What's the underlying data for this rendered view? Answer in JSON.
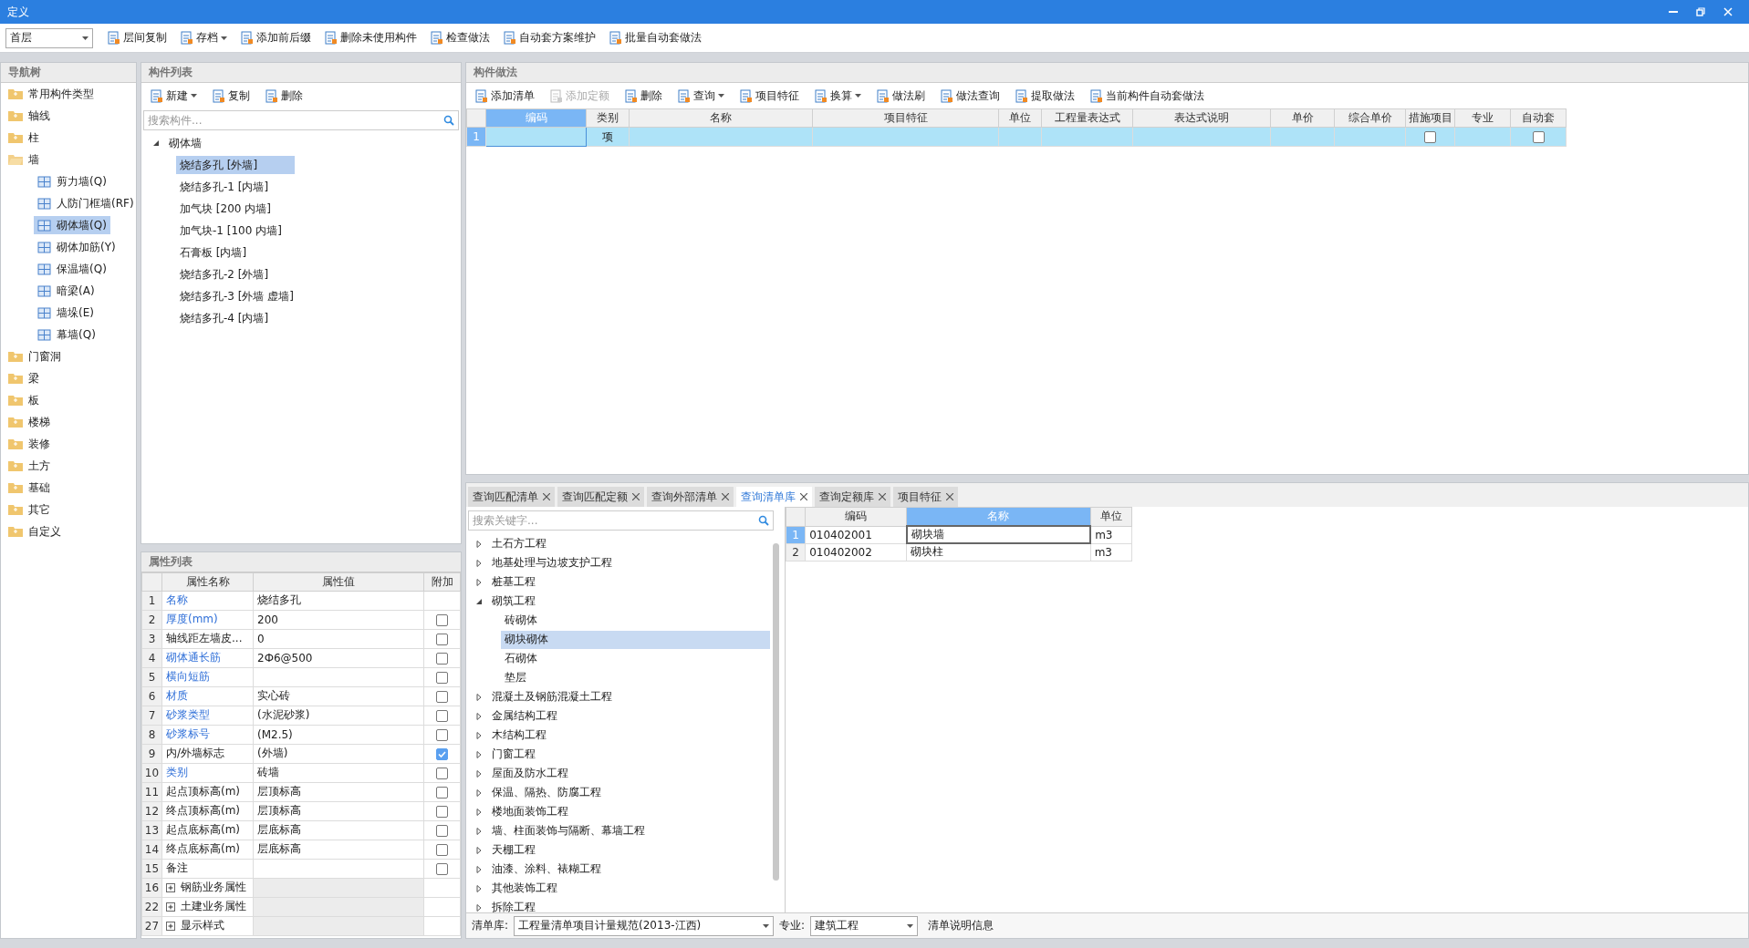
{
  "window": {
    "title": "定义"
  },
  "toolbar": {
    "floor": "首层",
    "buttons": [
      {
        "label": "层间复制",
        "dropdown": false
      },
      {
        "label": "存档",
        "dropdown": true
      },
      {
        "label": "添加前后缀",
        "dropdown": false
      },
      {
        "label": "删除未使用构件",
        "dropdown": false
      },
      {
        "label": "检查做法",
        "dropdown": false
      },
      {
        "label": "自动套方案维护",
        "dropdown": false
      },
      {
        "label": "批量自动套做法",
        "dropdown": false
      }
    ]
  },
  "nav_tree": {
    "title": "导航树",
    "items": [
      {
        "label": "常用构件类型",
        "expanded": false
      },
      {
        "label": "轴线",
        "expanded": false
      },
      {
        "label": "柱",
        "expanded": false
      },
      {
        "label": "墙",
        "expanded": true,
        "children": [
          {
            "label": "剪力墙(Q)",
            "selected": false
          },
          {
            "label": "人防门框墙(RF)",
            "selected": false
          },
          {
            "label": "砌体墙(Q)",
            "selected": true
          },
          {
            "label": "砌体加筋(Y)",
            "selected": false
          },
          {
            "label": "保温墙(Q)",
            "selected": false
          },
          {
            "label": "暗梁(A)",
            "selected": false
          },
          {
            "label": "墙垛(E)",
            "selected": false
          },
          {
            "label": "幕墙(Q)",
            "selected": false
          }
        ]
      },
      {
        "label": "门窗洞",
        "expanded": false
      },
      {
        "label": "梁",
        "expanded": false
      },
      {
        "label": "板",
        "expanded": false
      },
      {
        "label": "楼梯",
        "expanded": false
      },
      {
        "label": "装修",
        "expanded": false
      },
      {
        "label": "土方",
        "expanded": false
      },
      {
        "label": "基础",
        "expanded": false
      },
      {
        "label": "其它",
        "expanded": false
      },
      {
        "label": "自定义",
        "expanded": false
      }
    ]
  },
  "component_list": {
    "title": "构件列表",
    "buttons": [
      {
        "label": "新建",
        "dropdown": true
      },
      {
        "label": "复制",
        "dropdown": false
      },
      {
        "label": "删除",
        "dropdown": false
      }
    ],
    "search": {
      "placeholder": "搜索构件..."
    },
    "tree": {
      "label": "砌体墙",
      "expanded": true,
      "children": [
        {
          "label": "烧结多孔 [外墙]",
          "selected": true
        },
        {
          "label": "烧结多孔-1 [内墙]",
          "selected": false
        },
        {
          "label": "加气块 [200 内墙]",
          "selected": false
        },
        {
          "label": "加气块-1 [100 内墙]",
          "selected": false
        },
        {
          "label": "石膏板 [内墙]",
          "selected": false
        },
        {
          "label": "烧结多孔-2 [外墙]",
          "selected": false
        },
        {
          "label": "烧结多孔-3 [外墙 虚墙]",
          "selected": false
        },
        {
          "label": "烧结多孔-4 [内墙]",
          "selected": false
        }
      ]
    }
  },
  "properties": {
    "title": "属性列表",
    "columns": [
      "属性名称",
      "属性值",
      "附加"
    ],
    "rows": [
      {
        "index": "1",
        "kind": "field",
        "name": "名称",
        "public": true,
        "value": "烧结多孔"
      },
      {
        "index": "2",
        "kind": "field",
        "name": "厚度(mm)",
        "public": true,
        "value": "200",
        "checked": false
      },
      {
        "index": "3",
        "kind": "field",
        "name": "轴线距左墙皮...",
        "public": false,
        "value": "0",
        "checked": false
      },
      {
        "index": "4",
        "kind": "field",
        "name": "砌体通长筋",
        "public": true,
        "value": "2Ф6@500",
        "checked": false
      },
      {
        "index": "5",
        "kind": "field",
        "name": "横向短筋",
        "public": true,
        "checked": false
      },
      {
        "index": "6",
        "kind": "field",
        "name": "材质",
        "public": true,
        "value": "实心砖",
        "checked": false
      },
      {
        "index": "7",
        "kind": "field",
        "name": "砂浆类型",
        "public": true,
        "value": "(水泥砂浆)",
        "checked": false
      },
      {
        "index": "8",
        "kind": "field",
        "name": "砂浆标号",
        "public": true,
        "value": "(M2.5)",
        "checked": false
      },
      {
        "index": "9",
        "kind": "field",
        "name": "内/外墙标志",
        "public": false,
        "value": "(外墙)",
        "checked": true
      },
      {
        "index": "10",
        "kind": "field",
        "name": "类别",
        "public": true,
        "value": "砖墙",
        "checked": false
      },
      {
        "index": "11",
        "kind": "field",
        "name": "起点顶标高(m)",
        "public": false,
        "value": "层顶标高",
        "checked": false
      },
      {
        "index": "12",
        "kind": "field",
        "name": "终点顶标高(m)",
        "public": false,
        "value": "层顶标高",
        "checked": false
      },
      {
        "index": "13",
        "kind": "field",
        "name": "起点底标高(m)",
        "public": false,
        "value": "层底标高",
        "checked": false
      },
      {
        "index": "14",
        "kind": "field",
        "name": "终点底标高(m)",
        "public": false,
        "value": "层底标高",
        "checked": false
      },
      {
        "index": "15",
        "kind": "field",
        "name": "备注",
        "public": false,
        "checked": false
      },
      {
        "index": "16",
        "kind": "group",
        "name": "钢筋业务属性"
      },
      {
        "index": "22",
        "kind": "group",
        "name": "土建业务属性"
      },
      {
        "index": "27",
        "kind": "group",
        "name": "显示样式"
      }
    ]
  },
  "method": {
    "title": "构件做法",
    "buttons": [
      {
        "label": "添加清单",
        "dropdown": false,
        "disabled": false
      },
      {
        "label": "添加定额",
        "dropdown": false,
        "disabled": true
      },
      {
        "label": "删除",
        "dropdown": false,
        "disabled": false
      },
      {
        "label": "查询",
        "dropdown": true,
        "disabled": false
      },
      {
        "label": "项目特征",
        "dropdown": false,
        "disabled": false
      },
      {
        "label": "换算",
        "dropdown": true,
        "disabled": false
      },
      {
        "label": "做法刷",
        "dropdown": false,
        "disabled": false
      },
      {
        "label": "做法查询",
        "dropdown": false,
        "disabled": false
      },
      {
        "label": "提取做法",
        "dropdown": false,
        "disabled": false
      },
      {
        "label": "当前构件自动套做法",
        "dropdown": false,
        "disabled": false
      }
    ],
    "columns": [
      {
        "label": "编码",
        "selected": true
      },
      {
        "label": "类别",
        "selected": false
      },
      {
        "label": "名称",
        "selected": false
      },
      {
        "label": "项目特征",
        "selected": false
      },
      {
        "label": "单位",
        "selected": false
      },
      {
        "label": "工程量表达式",
        "selected": false
      },
      {
        "label": "表达式说明",
        "selected": false
      },
      {
        "label": "单价",
        "selected": false
      },
      {
        "label": "综合单价",
        "selected": false
      },
      {
        "label": "措施项目",
        "selected": false
      },
      {
        "label": "专业",
        "selected": false
      },
      {
        "label": "自动套",
        "selected": false
      }
    ],
    "rows": [
      {
        "index": "1",
        "selected": true,
        "type": "项",
        "measure": false,
        "auto": false
      }
    ]
  },
  "query": {
    "tabs": [
      {
        "label": "查询匹配清单",
        "selected": false
      },
      {
        "label": "查询匹配定额",
        "selected": false
      },
      {
        "label": "查询外部清单",
        "selected": false
      },
      {
        "label": "查询清单库",
        "selected": true
      },
      {
        "label": "查询定额库",
        "selected": false
      },
      {
        "label": "项目特征",
        "selected": false
      }
    ],
    "search": {
      "placeholder": "搜索关键字..."
    },
    "tree": [
      {
        "label": "土石方工程",
        "expanded": false
      },
      {
        "label": "地基处理与边坡支护工程",
        "expanded": false
      },
      {
        "label": "桩基工程",
        "expanded": false
      },
      {
        "label": "砌筑工程",
        "expanded": true,
        "children": [
          {
            "label": "砖砌体",
            "selected": false
          },
          {
            "label": "砌块砌体",
            "selected": true
          },
          {
            "label": "石砌体",
            "selected": false
          },
          {
            "label": "垫层",
            "selected": false
          }
        ]
      },
      {
        "label": "混凝土及钢筋混凝土工程",
        "expanded": false
      },
      {
        "label": "金属结构工程",
        "expanded": false
      },
      {
        "label": "木结构工程",
        "expanded": false
      },
      {
        "label": "门窗工程",
        "expanded": false
      },
      {
        "label": "屋面及防水工程",
        "expanded": false
      },
      {
        "label": "保温、隔热、防腐工程",
        "expanded": false
      },
      {
        "label": "楼地面装饰工程",
        "expanded": false
      },
      {
        "label": "墙、柱面装饰与隔断、幕墙工程",
        "expanded": false
      },
      {
        "label": "天棚工程",
        "expanded": false
      },
      {
        "label": "油漆、涂料、裱糊工程",
        "expanded": false
      },
      {
        "label": "其他装饰工程",
        "expanded": false
      },
      {
        "label": "拆除工程",
        "expanded": false
      }
    ],
    "grid": {
      "columns": [
        {
          "label": "编码",
          "selected": false
        },
        {
          "label": "名称",
          "selected": true
        },
        {
          "label": "单位",
          "selected": false
        }
      ],
      "rows": [
        {
          "index": "1",
          "code": "010402001",
          "name": "砌块墙",
          "unit": "m3",
          "selected": true
        },
        {
          "index": "2",
          "code": "010402002",
          "name": "砌块柱",
          "unit": "m3",
          "selected": false
        }
      ]
    },
    "footer": {
      "library_label": "清单库:",
      "library": "工程量清单项目计量规范(2013-江西)",
      "specialty_label": "专业:",
      "specialty": "建筑工程",
      "info_button": "清单说明信息"
    }
  }
}
